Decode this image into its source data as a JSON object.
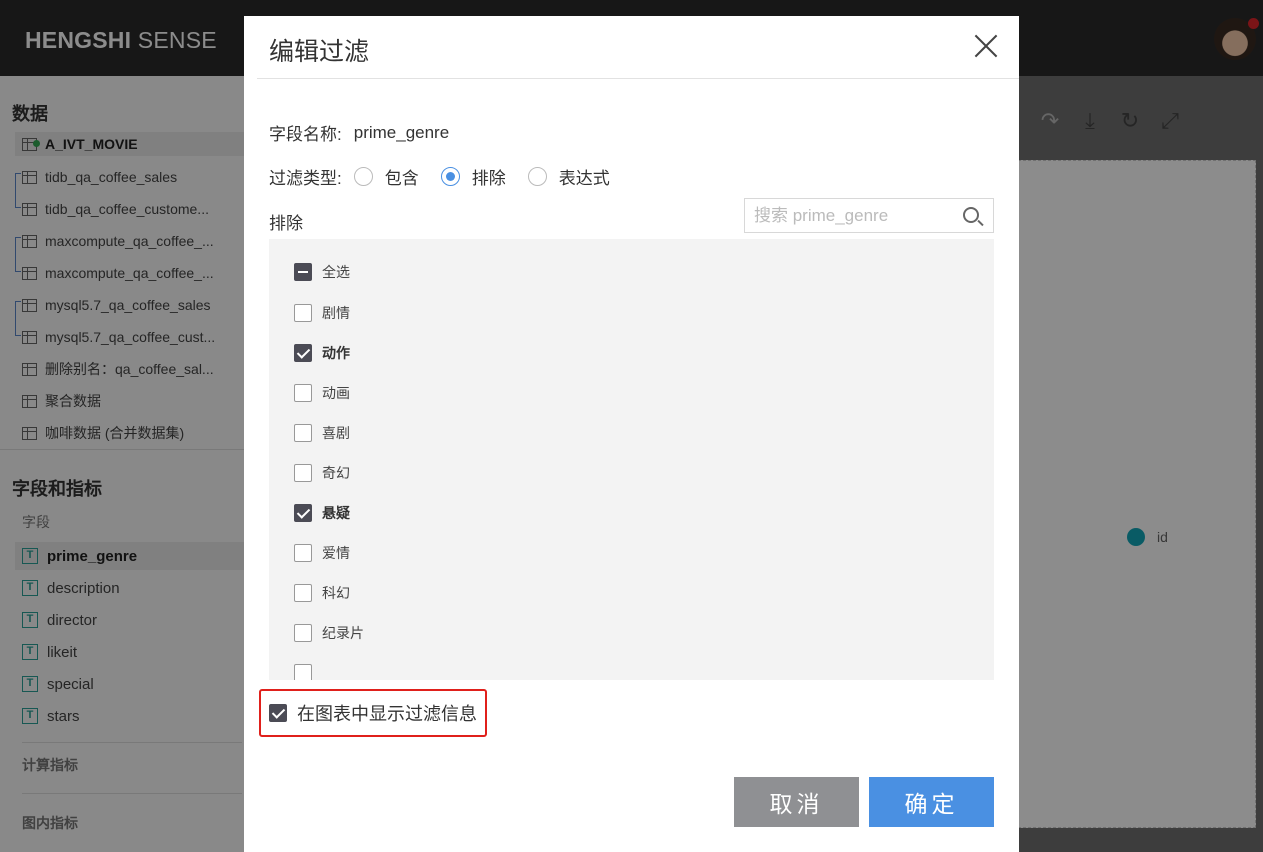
{
  "app": {
    "brand_bold": "HENGSHI",
    "brand_light": "SENSE"
  },
  "sidebar": {
    "data_title": "数据",
    "datasets": [
      "A_IVT_MOVIE",
      "tidb_qa_coffee_sales",
      "tidb_qa_coffee_custome...",
      "maxcompute_qa_coffee_...",
      "maxcompute_qa_coffee_...",
      "mysql5.7_qa_coffee_sales",
      "mysql5.7_qa_coffee_cust...",
      "删除别名：qa_coffee_sal...",
      "聚合数据",
      "咖啡数据 (合并数据集)"
    ],
    "fields_title": "字段和指标",
    "fields_sub": "字段",
    "fields": [
      "prime_genre",
      "description",
      "director",
      "likeit",
      "special",
      "stars"
    ],
    "field_type_icon": "T",
    "calc_metrics": "计算指标",
    "chart_metrics": "图内指标"
  },
  "canvas": {
    "legend_label": "id",
    "legend_color": "#11a6b8"
  },
  "modal": {
    "title": "编辑过滤",
    "field_name_label": "字段名称:",
    "field_name_value": "prime_genre",
    "filter_type_label": "过滤类型:",
    "filter_types": [
      {
        "label": "包含",
        "selected": false
      },
      {
        "label": "排除",
        "selected": true
      },
      {
        "label": "表达式",
        "selected": false
      }
    ],
    "list_label": "排除",
    "search_placeholder": "搜索 prime_genre",
    "select_all_label": "全选",
    "options": [
      {
        "label": "剧情",
        "checked": false
      },
      {
        "label": "动作",
        "checked": true
      },
      {
        "label": "动画",
        "checked": false
      },
      {
        "label": "喜剧",
        "checked": false
      },
      {
        "label": "奇幻",
        "checked": false
      },
      {
        "label": "悬疑",
        "checked": true
      },
      {
        "label": "爱情",
        "checked": false
      },
      {
        "label": "科幻",
        "checked": false
      },
      {
        "label": "纪录片",
        "checked": false
      }
    ],
    "show_info_label": "在图表中显示过滤信息",
    "show_info_checked": true,
    "cancel_label": "取消",
    "ok_label": "确定",
    "accent_color": "#4a90e2",
    "highlight_color": "#e0201b"
  }
}
